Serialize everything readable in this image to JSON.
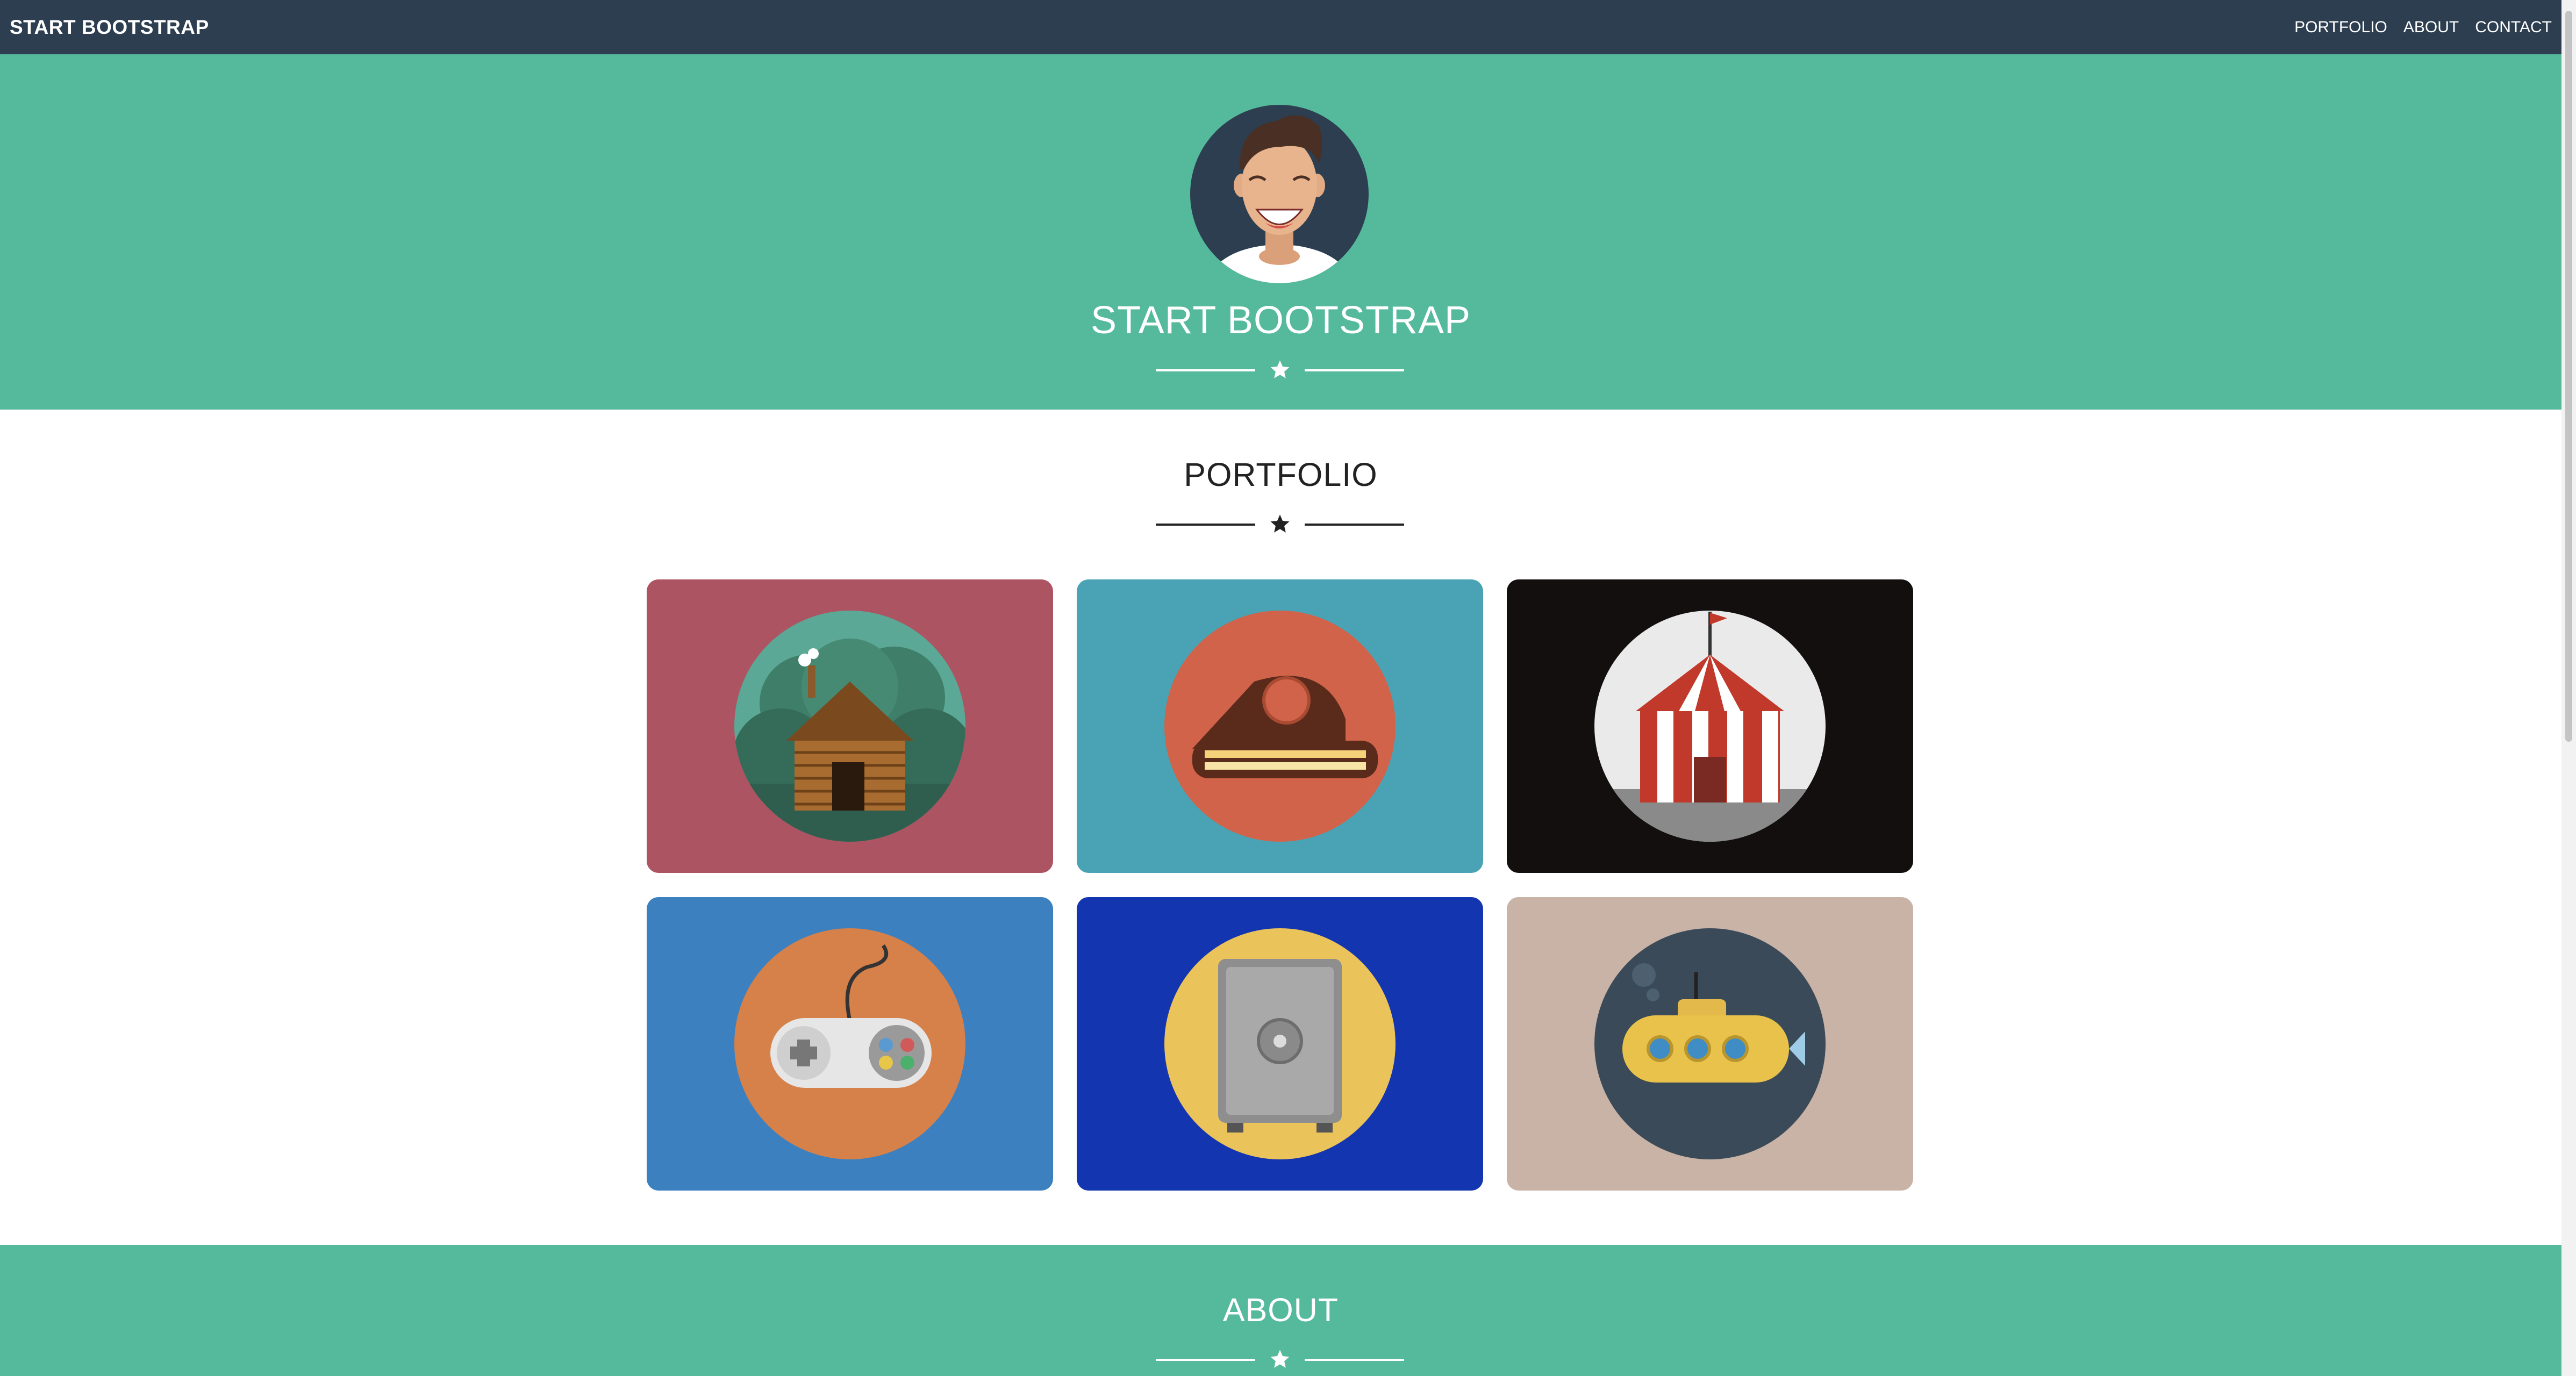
{
  "navbar": {
    "brand": "START BOOTSTRAP",
    "links": [
      "PORTFOLIO",
      "ABOUT",
      "CONTACT"
    ]
  },
  "hero": {
    "title": "START BOOTSTRAP",
    "divider_icon": "star-icon"
  },
  "portfolio": {
    "title": "PORTFOLIO",
    "divider_icon": "star-icon",
    "items": [
      {
        "icon": "log-cabin-icon",
        "background": "#ad5462",
        "circle": "#5aa895"
      },
      {
        "icon": "cake-slice-icon",
        "background": "#4aa3b4",
        "circle": "#d1634a"
      },
      {
        "icon": "circus-tent-icon",
        "background": "#130f0f",
        "circle": "#eaeaea"
      },
      {
        "icon": "game-controller-icon",
        "background": "#3c80bf",
        "circle": "#d6804a"
      },
      {
        "icon": "safe-icon",
        "background": "#1435b0",
        "circle": "#eac35a"
      },
      {
        "icon": "submarine-icon",
        "background": "#c8b3a6",
        "circle": "#3a4a58"
      }
    ]
  },
  "about": {
    "title": "ABOUT",
    "divider_icon": "star-icon"
  },
  "colors": {
    "navbar": "#2c3e50",
    "primary": "#55b99b",
    "white": "#ffffff",
    "dark_text": "#222222"
  }
}
